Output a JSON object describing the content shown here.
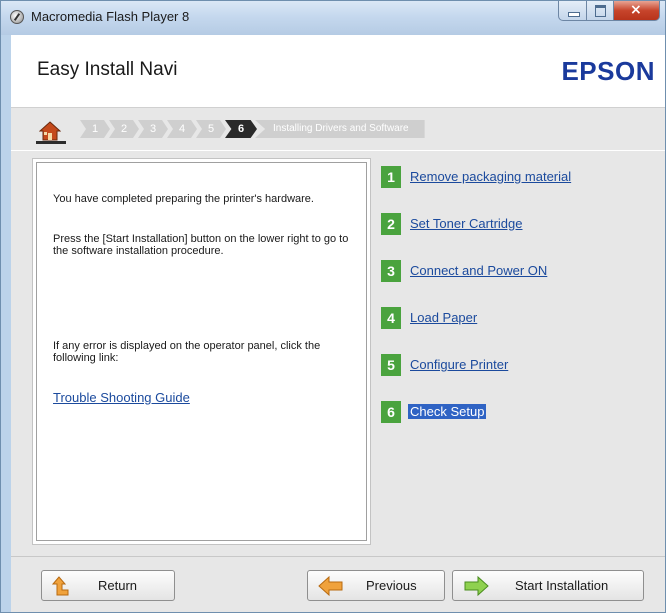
{
  "window": {
    "title": "Macromedia Flash Player 8"
  },
  "header": {
    "app_title": "Easy Install Navi",
    "brand": "EPSON"
  },
  "steps": {
    "items": [
      "1",
      "2",
      "3",
      "4",
      "5",
      "6"
    ],
    "active": "6",
    "final_label": "Installing Drivers and Software"
  },
  "left_panel": {
    "para1": "You have completed preparing the printer's hardware.",
    "para2": "Press the [Start Installation] button on the lower right to go to the software installation procedure.",
    "para3": "If any error is displayed on the operator panel, click the following link:",
    "trouble_link": "Trouble Shooting Guide"
  },
  "checklist": [
    {
      "num": "1",
      "label": "Remove packaging material"
    },
    {
      "num": "2",
      "label": "Set Toner Cartridge"
    },
    {
      "num": "3",
      "label": "Connect and Power ON"
    },
    {
      "num": "4",
      "label": "Load Paper"
    },
    {
      "num": "5",
      "label": "Configure Printer"
    },
    {
      "num": "6",
      "label": "Check Setup"
    }
  ],
  "buttons": {
    "return": "Return",
    "previous": "Previous",
    "start": "Start Installation"
  },
  "colors": {
    "brand": "#1a3a9c",
    "step_badge": "#4aa33e",
    "link": "#1b4a9d",
    "selection": "#2f63c4"
  }
}
